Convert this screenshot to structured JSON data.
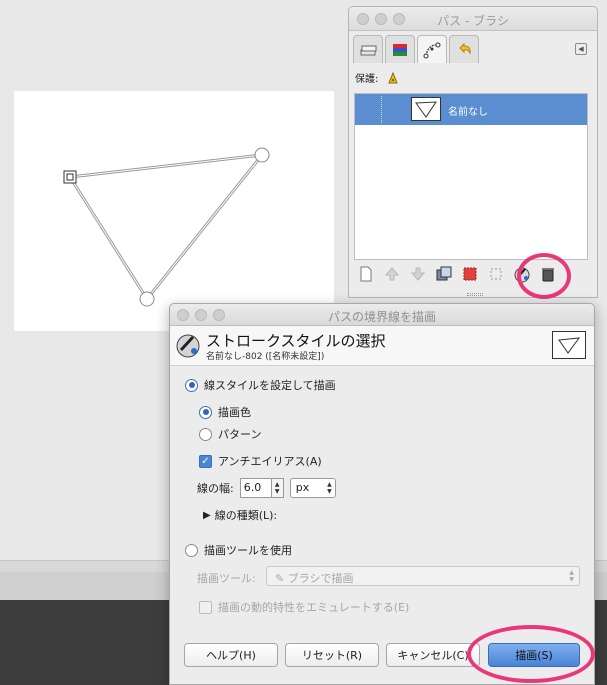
{
  "paths_panel": {
    "title": "パス - ブラシ",
    "lock_label": "保護:",
    "path_name": "名前なし"
  },
  "dialog": {
    "window_title": "パスの境界線を描画",
    "header_title": "ストロークスタイルの選択",
    "header_subtitle": "名前なし-802 ([名称未設定])",
    "stroke_line_label": "線スタイルを設定して描画",
    "solid_color_label": "描画色",
    "pattern_label": "パターン",
    "antialias_label": "アンチエイリアス(A)",
    "line_width_label": "線の幅:",
    "line_width_value": "6.0",
    "unit_value": "px",
    "line_style_label": "線の種類(L):",
    "paint_tool_label": "描画ツールを使用",
    "paint_tool_field_label": "描画ツール:",
    "paint_tool_value": "ブラシで描画",
    "emulate_dynamics_label": "描画の動的特性をエミュレートする(E)",
    "help_button": "ヘルプ(H)",
    "reset_button": "リセット(R)",
    "cancel_button": "キャンセル(C)",
    "stroke_button": "描画(S)"
  },
  "colors": {
    "selection": "#5b8ed0",
    "highlight_annotation": "#e8387a",
    "primary_button": "#4a84d6"
  }
}
